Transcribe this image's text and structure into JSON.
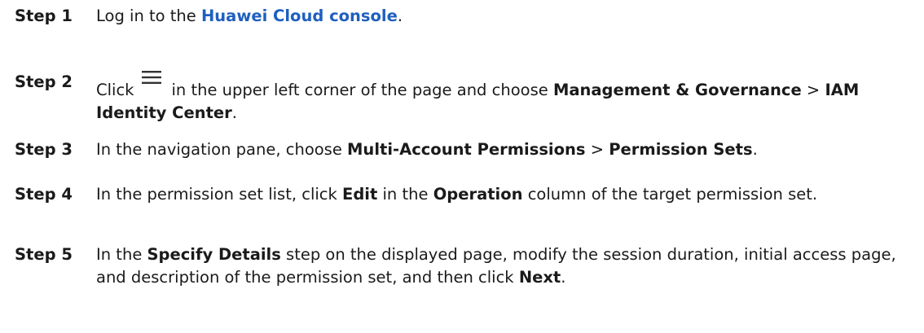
{
  "steps": [
    {
      "label": "Step 1",
      "text_before": "Log in to the ",
      "link": "Huawei Cloud console",
      "text_after": "."
    },
    {
      "label": "Step 2",
      "text_before": "Click",
      "icon": "hamburger-menu-icon",
      "text_mid": "in the upper left corner of the page and choose ",
      "bold1": "Management & Governance",
      "sep": " > ",
      "bold2": "IAM Identity Center",
      "text_after": "."
    },
    {
      "label": "Step 3",
      "text_before": "In the navigation pane, choose ",
      "bold1": "Multi-Account Permissions",
      "sep": " > ",
      "bold2": "Permission Sets",
      "text_after": "."
    },
    {
      "label": "Step 4",
      "text_before": "In the permission set list, click ",
      "bold1": "Edit",
      "text_mid": " in the ",
      "bold2": "Operation",
      "text_after": " column of the target permission set."
    },
    {
      "label": "Step 5",
      "text_before": "In the ",
      "bold1": "Specify Details",
      "text_mid": " step on the displayed page, modify the session duration, initial access page, and description of the permission set, and then click ",
      "bold2": "Next",
      "text_after": "."
    }
  ],
  "colors": {
    "link": "#1f5fbf",
    "text": "#1a1a1a"
  }
}
